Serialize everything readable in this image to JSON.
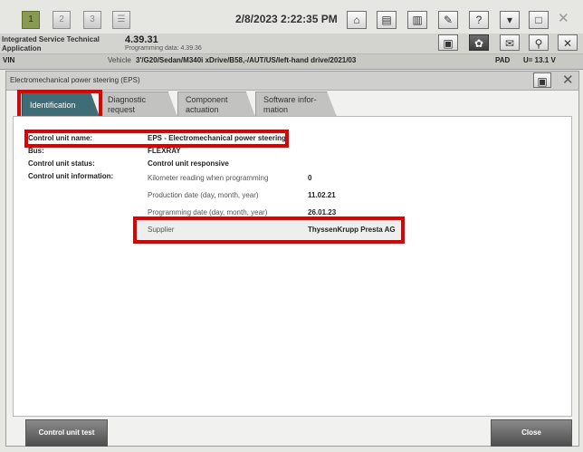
{
  "toolbar": {
    "btn1": "1",
    "btn2": "2",
    "btn3": "3",
    "datetime": "2/8/2023 2:22:35 PM"
  },
  "app": {
    "name_line1": "Integrated Service Technical",
    "name_line2": "Application",
    "version": "4.39.31",
    "programming_data": "Programming data: 4.39.36"
  },
  "vin_row": {
    "vin_label": "VIN",
    "vehicle_label": "Vehicle",
    "vehicle_value": "3'/G20/Sedan/M340i xDrive/B58,-/AUT/US/left-hand drive/2021/03",
    "pad": "PAD",
    "voltage": "U= 13.1 V"
  },
  "panel": {
    "title": "Electromechanical power steering (EPS)",
    "tabs": [
      {
        "line1": "Identification",
        "line2": ""
      },
      {
        "line1": "Diagnostic",
        "line2": "request"
      },
      {
        "line1": "Component",
        "line2": "actuation"
      },
      {
        "line1": "Software infor-",
        "line2": "mation"
      }
    ]
  },
  "info": {
    "control_unit_name_label": "Control unit name:",
    "control_unit_name_value": "EPS - Electromechanical power steering",
    "bus_label": "Bus:",
    "bus_value": "FLEXRAY",
    "status_label": "Control unit status:",
    "status_value": "Control unit responsive",
    "information_label": "Control unit information:",
    "km_label": "Kilometer reading when programming",
    "km_value": "0",
    "production_label": "Production date (day, month, year)",
    "production_value": "11.02.21",
    "programming_label": "Programming date (day, month, year)",
    "programming_value": "26.01.23",
    "supplier_label": "Supplier",
    "supplier_value": "ThyssenKrupp Presta AG"
  },
  "footer": {
    "control_unit_test": "Control unit test",
    "close": "Close"
  },
  "colors": {
    "highlight": "#e10000",
    "active_tab": "#3e6d77"
  }
}
